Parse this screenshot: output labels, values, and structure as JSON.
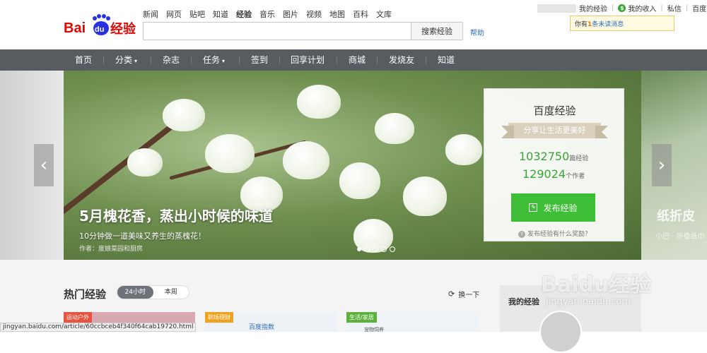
{
  "topnav": [
    "新闻",
    "网页",
    "贴吧",
    "知道",
    "经验",
    "音乐",
    "图片",
    "视频",
    "地图",
    "百科",
    "文库"
  ],
  "search": {
    "button": "搜索经验",
    "help": "帮助"
  },
  "userbar": {
    "my_exp": "我的经验",
    "income": "我的收入",
    "pm": "私信",
    "home": "百度首页"
  },
  "notice": {
    "prefix": "你有",
    "count": "1",
    "suffix": "条未读消息"
  },
  "navbar": [
    "首页",
    "分类",
    "杂志",
    "任务",
    "签到",
    "回享计划",
    "商城",
    "发烧友",
    "知道"
  ],
  "hero": {
    "title": "5月槐花香，蒸出小时候的味道",
    "subtitle": "10分钟做一道美味又养生的蒸槐花！",
    "author": "作者：度娘菜园和厨房",
    "right_title": "纸折皮",
    "right_sub": "小巴 · 折叠纸巾"
  },
  "card": {
    "title": "百度经验",
    "slogan": "分享让生活更美好",
    "articles": "1032750",
    "articles_unit": "篇经验",
    "authors": "129024",
    "authors_unit": "个作者",
    "publish": "发布经验",
    "reward": "发布经验有什么奖励？"
  },
  "hot": {
    "title": "热门经验",
    "tab_24h": "24小时",
    "tab_week": "本周",
    "refresh": "换一下"
  },
  "tiles": [
    {
      "tag": "运动户外",
      "tag_color": "#e8543f"
    },
    {
      "tag": "职场理财",
      "tag_color": "#f0a21e",
      "text": "百度指数"
    },
    {
      "tag": "生活/家居",
      "tag_color": "#5cb13c",
      "text": "宠物饲养"
    }
  ],
  "my_exp_title": "我的经验",
  "status_url": "jingyan.baidu.com/article/60ccbceb4f340f64cab19720.html",
  "watermark": {
    "logo": "Baidu经验",
    "url": "jingyan.baidu.com"
  }
}
